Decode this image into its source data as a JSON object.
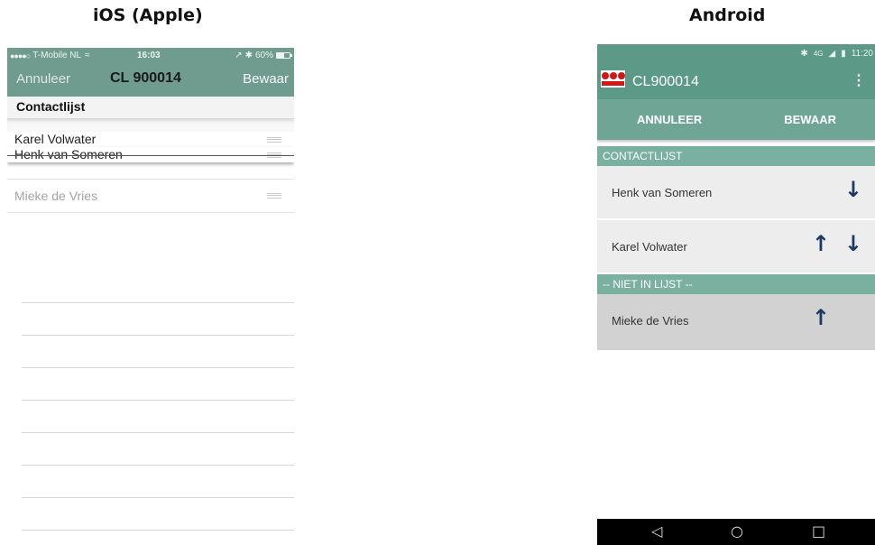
{
  "headings": {
    "ios": "iOS (Apple)",
    "android": "Android"
  },
  "ios": {
    "status": {
      "signal": "●●●●○",
      "carrier": "T-Mobile NL",
      "wifi": "≈",
      "time": "16:03",
      "location": "↗",
      "bluetooth": "✱",
      "battery": "60%"
    },
    "nav": {
      "cancel": "Annuleer",
      "title": "CL 900014",
      "save": "Bewaar"
    },
    "section": "Contactlijst",
    "rows": [
      {
        "name": "Karel Volwater"
      },
      {
        "name": "Henk van Someren"
      },
      {
        "name": "Mieke de Vries"
      }
    ]
  },
  "android": {
    "status": {
      "bluetooth": "✱",
      "network": "4G",
      "signal": "◢",
      "battery": "▮",
      "time": "11:20"
    },
    "toolbar": {
      "title": "CL900014",
      "menu": "⋮"
    },
    "actions": {
      "cancel": "ANNULEER",
      "save": "BEWAAR"
    },
    "sections": {
      "list": "CONTACTLIJST",
      "not_in_list": "-- NIET IN LIJST --"
    },
    "list_rows": [
      {
        "name": "Henk van Someren"
      },
      {
        "name": "Karel Volwater"
      }
    ],
    "other_rows": [
      {
        "name": "Mieke de Vries"
      }
    ],
    "arrows": {
      "up": "↑",
      "down": "↓"
    },
    "navbar": {
      "back": "◁",
      "home": "○",
      "recents": "□"
    },
    "colors": {
      "primary": "#5c9987",
      "arrow": "#1d3a66",
      "logo_red": "#d01818"
    }
  }
}
